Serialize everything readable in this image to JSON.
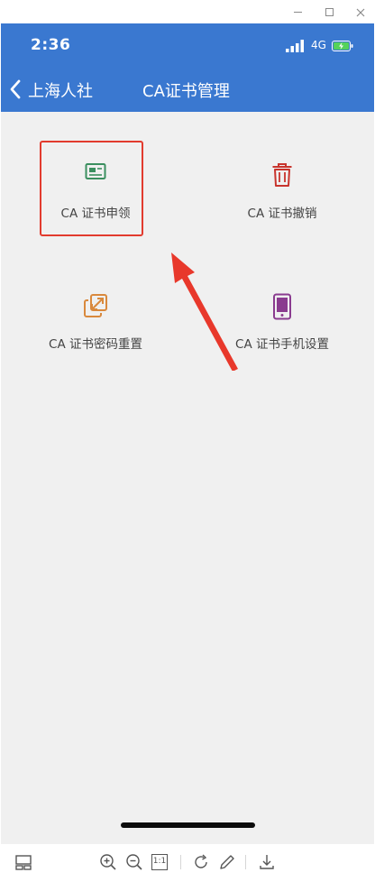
{
  "status_bar": {
    "time": "2:36",
    "network": "4G"
  },
  "header": {
    "back_label": "上海人社",
    "title": "CA证书管理"
  },
  "tiles": [
    {
      "label": "CA 证书申领",
      "icon": "id-card-icon",
      "color": "#3b8f5f"
    },
    {
      "label": "CA 证书撤销",
      "icon": "trash-icon",
      "color": "#c8342d"
    },
    {
      "label": "CA 证书密码重置",
      "icon": "password-reset-icon",
      "color": "#d9893d"
    },
    {
      "label": "CA 证书手机设置",
      "icon": "mobile-phone-icon",
      "color": "#8a3b8f"
    }
  ],
  "annotation": {
    "highlight_color": "#e23b2e"
  },
  "toolbar": {
    "one_to_one": "1:1"
  },
  "colors": {
    "header_bg": "#3a78d0",
    "page_bg": "#f0f0f0"
  }
}
